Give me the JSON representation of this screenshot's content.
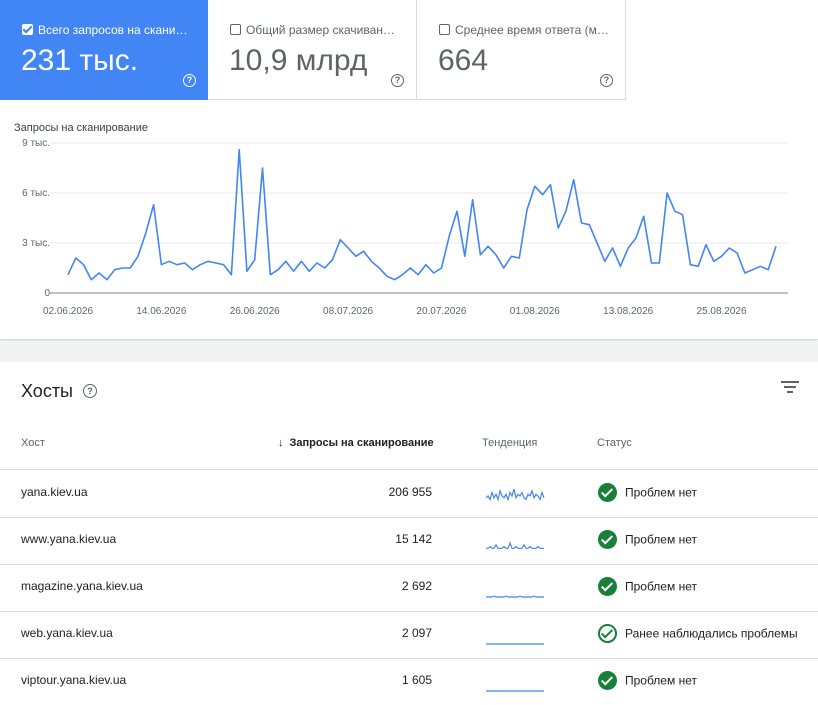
{
  "metrics": [
    {
      "label": "Всего запросов на скани…",
      "value": "231 тыс.",
      "selected": true
    },
    {
      "label": "Общий размер скачиван…",
      "value": "10,9 млрд",
      "selected": false
    },
    {
      "label": "Среднее время ответа (м…",
      "value": "664",
      "selected": false
    }
  ],
  "chart_data": {
    "type": "line",
    "title": "Запросы на сканирование",
    "ylim": [
      0,
      9000
    ],
    "yticks": [
      {
        "v": 0,
        "label": "0"
      },
      {
        "v": 3000,
        "label": "3 тыс."
      },
      {
        "v": 6000,
        "label": "6 тыс."
      },
      {
        "v": 9000,
        "label": "9 тыс."
      }
    ],
    "xticks": [
      {
        "i": 0,
        "label": "02.06.2026"
      },
      {
        "i": 12,
        "label": "14.06.2026"
      },
      {
        "i": 24,
        "label": "26.06.2026"
      },
      {
        "i": 36,
        "label": "08.07.2026"
      },
      {
        "i": 48,
        "label": "20.07.2026"
      },
      {
        "i": 60,
        "label": "01.08.2026"
      },
      {
        "i": 72,
        "label": "13.08.2026"
      },
      {
        "i": 84,
        "label": "25.08.2026"
      }
    ],
    "color": "#4285f4",
    "values": [
      1100,
      2100,
      1700,
      800,
      1200,
      800,
      1400,
      1500,
      1500,
      2200,
      3600,
      5300,
      1700,
      1900,
      1700,
      1800,
      1400,
      1700,
      1900,
      1800,
      1700,
      1100,
      8600,
      1300,
      2000,
      7500,
      1100,
      1400,
      1900,
      1300,
      1900,
      1300,
      1800,
      1500,
      2000,
      3200,
      2700,
      2200,
      2500,
      1900,
      1500,
      1000,
      800,
      1100,
      1500,
      1100,
      1700,
      1200,
      1500,
      3400,
      4900,
      2200,
      5600,
      2300,
      2800,
      2300,
      1500,
      2200,
      2100,
      5000,
      6400,
      5900,
      6500,
      3900,
      4900,
      6800,
      4200,
      4100,
      3000,
      1900,
      2700,
      1600,
      2700,
      3300,
      4600,
      1800,
      1800,
      6000,
      4900,
      4700,
      1700,
      1600,
      2900,
      1900,
      2200,
      2700,
      2400,
      1200,
      1400,
      1600,
      1400,
      2800
    ]
  },
  "hosts": {
    "title": "Хосты",
    "columns": {
      "host": "Хост",
      "requests": "Запросы на сканирование",
      "trend": "Тенденция",
      "status": "Статус"
    },
    "rows": [
      {
        "host": "yana.kiev.ua",
        "requests": "206 955",
        "status": "Проблем нет",
        "status_type": "ok",
        "trend": [
          3,
          4,
          2,
          6,
          3,
          5,
          2,
          7,
          4,
          3,
          5,
          2,
          6,
          4,
          8,
          3,
          5,
          4,
          6,
          3,
          2,
          5,
          4,
          7,
          3,
          5,
          4,
          2,
          6,
          3
        ]
      },
      {
        "host": "www.yana.kiev.ua",
        "requests": "15 142",
        "status": "Проблем нет",
        "status_type": "ok",
        "trend": [
          1,
          1,
          2,
          1,
          1,
          3,
          1,
          1,
          1,
          2,
          1,
          1,
          4,
          1,
          1,
          2,
          1,
          1,
          1,
          3,
          1,
          1,
          2,
          1,
          1,
          1,
          2,
          1,
          1,
          1
        ]
      },
      {
        "host": "magazine.yana.kiev.ua",
        "requests": "2 692",
        "status": "Проблем нет",
        "status_type": "ok",
        "trend": [
          0,
          0,
          0,
          0,
          0.5,
          0,
          0,
          0,
          0,
          0,
          0.5,
          0,
          0,
          0,
          0,
          0,
          0,
          0.5,
          0,
          0,
          0,
          0,
          0,
          0,
          0.5,
          0,
          0,
          0,
          0,
          0
        ]
      },
      {
        "host": "web.yana.kiev.ua",
        "requests": "2 097",
        "status": "Ранее наблюдались проблемы",
        "status_type": "past",
        "trend": [
          0,
          0,
          0,
          0,
          0,
          0,
          0,
          0,
          0,
          0,
          0,
          0,
          0,
          0,
          0,
          0,
          0,
          0,
          0,
          0,
          0,
          0,
          0,
          0,
          0,
          0,
          0,
          0,
          0,
          0
        ]
      },
      {
        "host": "viptour.yana.kiev.ua",
        "requests": "1 605",
        "status": "Проблем нет",
        "status_type": "ok",
        "trend": [
          0,
          0,
          0,
          0,
          0,
          0,
          0,
          0,
          0,
          0,
          0,
          0,
          0,
          0,
          0,
          0,
          0,
          0,
          0,
          0,
          0,
          0,
          0,
          0,
          0,
          0,
          0,
          0,
          0,
          0
        ]
      }
    ]
  }
}
